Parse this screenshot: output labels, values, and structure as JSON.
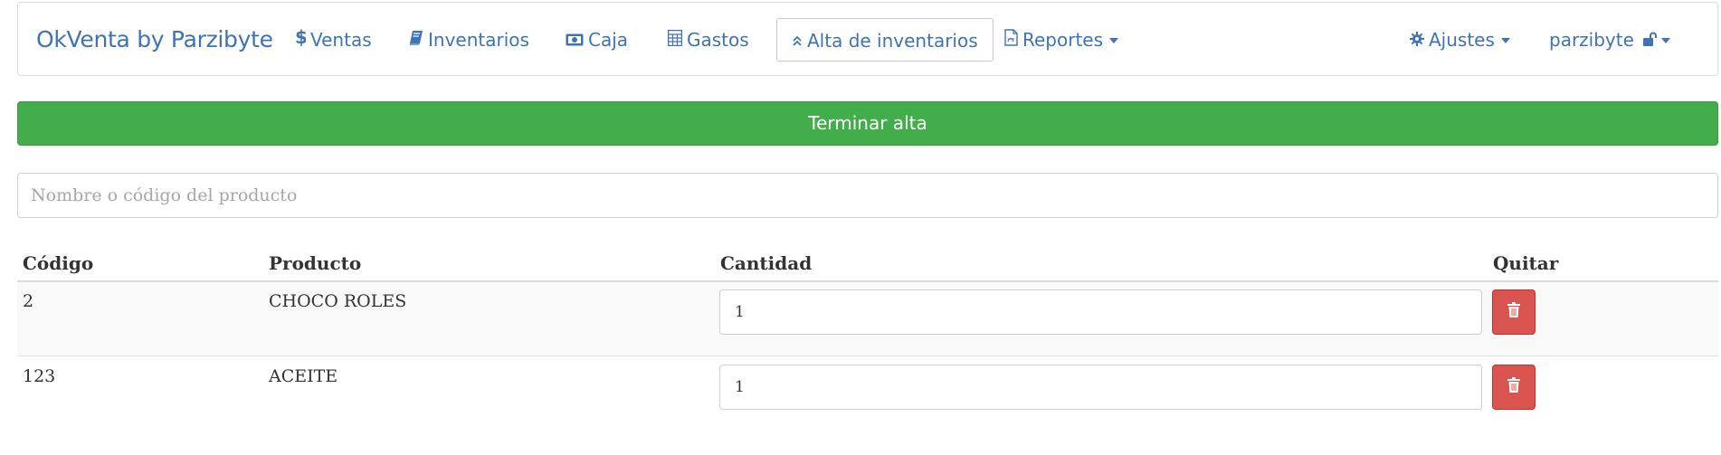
{
  "navbar": {
    "brand": "OkVenta by Parzibyte",
    "items": [
      {
        "label": "Ventas",
        "icon": "dollar-icon"
      },
      {
        "label": "Inventarios",
        "icon": "book-icon"
      },
      {
        "label": "Caja",
        "icon": "money-icon"
      },
      {
        "label": "Gastos",
        "icon": "calculator-icon"
      },
      {
        "label": "Alta de inventarios",
        "icon": "double-chevron-up-icon",
        "active": true
      },
      {
        "label": "Reportes",
        "icon": "pdf-file-icon",
        "dropdown": true
      }
    ],
    "right_items": [
      {
        "label": "Ajustes",
        "icon": "gear-icon",
        "dropdown": true
      },
      {
        "label": "parzibyte",
        "icon": "unlock-icon",
        "dropdown": true
      }
    ]
  },
  "finish_button": {
    "label": "Terminar alta",
    "color": "#42ad4a"
  },
  "search": {
    "placeholder": "Nombre o código del producto",
    "value": ""
  },
  "table": {
    "headers": {
      "code": "Código",
      "product": "Producto",
      "quantity": "Cantidad",
      "remove": "Quitar"
    },
    "rows": [
      {
        "code": "2",
        "product": "CHOCO ROLES",
        "quantity": "1"
      },
      {
        "code": "123",
        "product": "ACEITE",
        "quantity": "1"
      }
    ]
  },
  "colors": {
    "link": "#3e73b9",
    "success": "#42ad4a",
    "danger": "#d9534f"
  }
}
